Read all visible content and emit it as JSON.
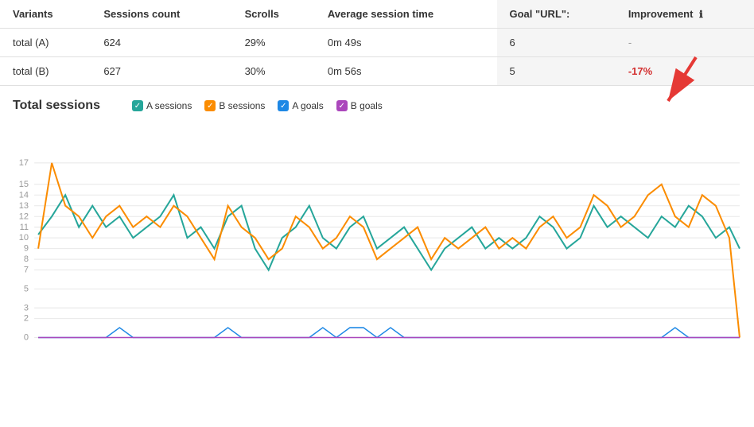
{
  "table": {
    "headers": [
      "Variants",
      "Sessions count",
      "Scrolls",
      "Average session time",
      "Goal \"URL\":",
      "Improvement"
    ],
    "rows": [
      {
        "variant": "total (A)",
        "sessions": "624",
        "scrolls": "29%",
        "avg_time": "0m 49s",
        "goal": "6",
        "improvement": "-",
        "improvement_type": "neutral"
      },
      {
        "variant": "total (B)",
        "sessions": "627",
        "scrolls": "30%",
        "avg_time": "0m 56s",
        "goal": "5",
        "improvement": "-17%",
        "improvement_type": "negative"
      }
    ]
  },
  "chart": {
    "title": "Total sessions",
    "legend": [
      {
        "label": "A sessions",
        "color": "#26a69a",
        "shape": "check"
      },
      {
        "label": "B sessions",
        "color": "#fb8c00",
        "shape": "check"
      },
      {
        "label": "A goals",
        "color": "#1e88e5",
        "shape": "check"
      },
      {
        "label": "B goals",
        "color": "#ab47bc",
        "shape": "check"
      }
    ],
    "y_labels": [
      "0",
      "2",
      "3",
      "5",
      "7",
      "8",
      "9",
      "10",
      "11",
      "12",
      "13",
      "14",
      "15",
      "17"
    ],
    "y_ticks": [
      0,
      2,
      3,
      5,
      7,
      8,
      9,
      10,
      11,
      12,
      13,
      14,
      15,
      17
    ]
  },
  "info_icon": "ℹ"
}
